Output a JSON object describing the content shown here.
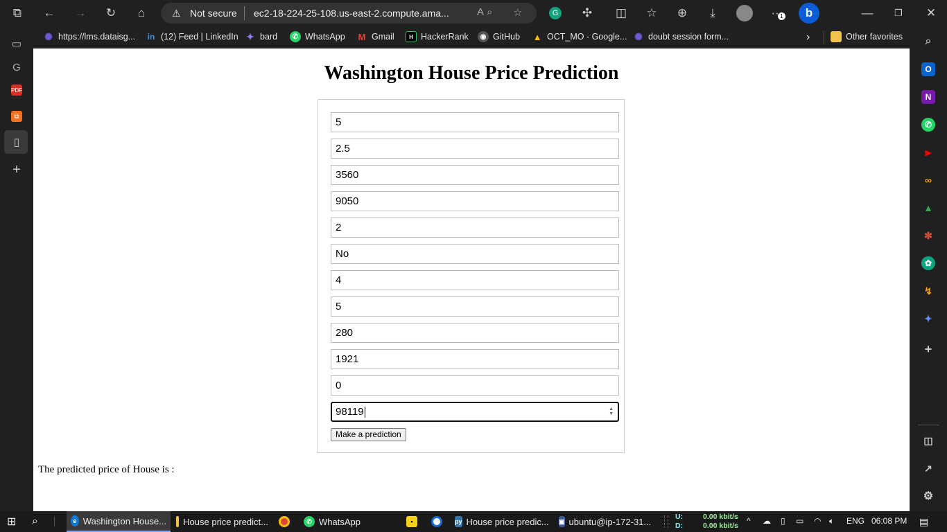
{
  "browser": {
    "security_label": "Not secure",
    "url": "ec2-18-224-25-108.us-east-2.compute.ama...",
    "extension_badge": "1"
  },
  "bookmarks": {
    "items": [
      {
        "label": "https://lms.dataisg...",
        "icon": "web-icon"
      },
      {
        "label": "(12) Feed | LinkedIn",
        "icon": "linkedin-icon"
      },
      {
        "label": "bard",
        "icon": "bard-icon"
      },
      {
        "label": "WhatsApp",
        "icon": "whatsapp-icon"
      },
      {
        "label": "Gmail",
        "icon": "gmail-icon"
      },
      {
        "label": "HackerRank",
        "icon": "hackerrank-icon"
      },
      {
        "label": "GitHub",
        "icon": "github-icon"
      },
      {
        "label": "OCT_MO - Google...",
        "icon": "drive-icon"
      },
      {
        "label": "doubt session form...",
        "icon": "web-icon"
      }
    ],
    "other_favorites": "Other favorites"
  },
  "page": {
    "title": "Washington House Price Prediction",
    "fields": [
      {
        "value": "5"
      },
      {
        "value": "2.5"
      },
      {
        "value": "3560"
      },
      {
        "value": "9050"
      },
      {
        "value": "2"
      },
      {
        "value": "No"
      },
      {
        "value": "4"
      },
      {
        "value": "5"
      },
      {
        "value": "280"
      },
      {
        "value": "1921"
      },
      {
        "value": "0"
      },
      {
        "value": "98119"
      }
    ],
    "submit_label": "Make a prediction",
    "result_text": "The predicted price of House is :"
  },
  "taskbar": {
    "items": [
      {
        "label": "Washington House...",
        "icon": "edge-icon",
        "active": true
      },
      {
        "label": "House price predict...",
        "icon": "file-explorer-icon"
      },
      {
        "label": "",
        "icon": "chrome-icon"
      },
      {
        "label": "WhatsApp",
        "icon": "whatsapp-icon"
      },
      {
        "label": "",
        "icon": "sticky-notes-icon"
      },
      {
        "label": "",
        "icon": "record-icon"
      },
      {
        "label": "House price predic...",
        "icon": "python-icon"
      },
      {
        "label": "ubuntu@ip-172-31...",
        "icon": "putty-icon"
      }
    ],
    "net_upload_label": "U:",
    "net_download_label": "D:",
    "net_upload": "0.00 kbit/s",
    "net_download": "0.00 kbit/s",
    "language": "ENG",
    "time": "06:08 PM"
  }
}
